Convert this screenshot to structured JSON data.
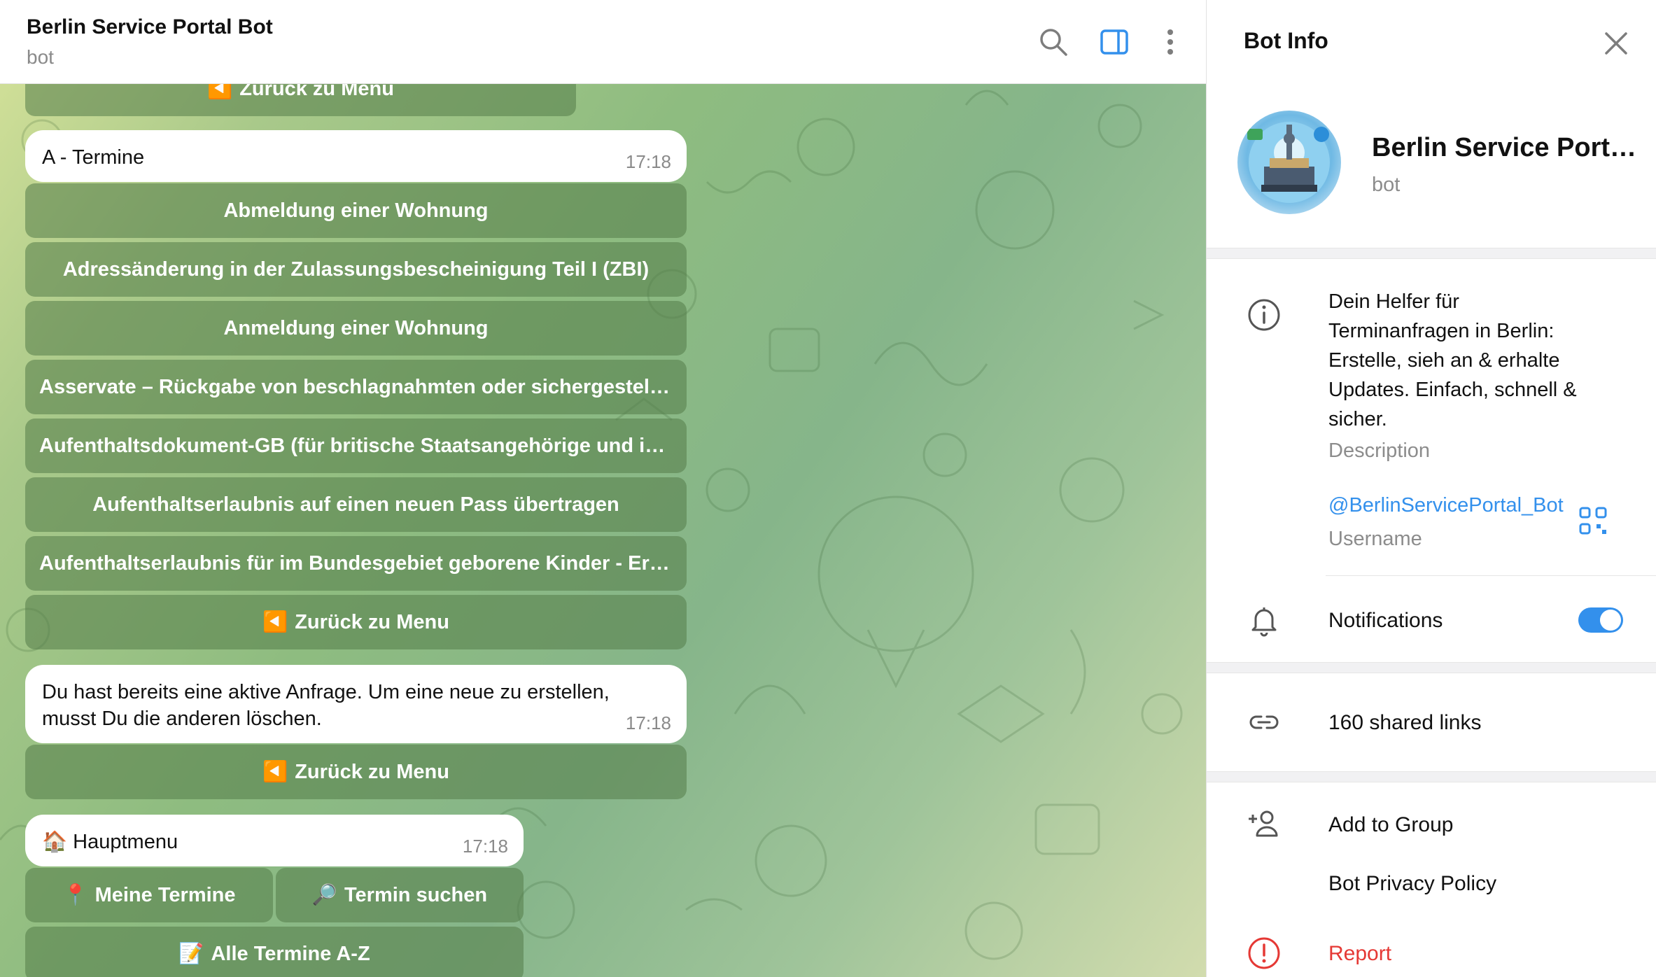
{
  "chat": {
    "title": "Berlin Service Portal Bot",
    "subtitle": "bot",
    "header_icons": [
      "search-icon",
      "sidebar-toggle-icon",
      "more-vertical-icon"
    ]
  },
  "messages": [
    {
      "text": "A - Termine",
      "time": "17:18",
      "buttons": [
        "Abmeldung einer Wohnung",
        "Adressänderung in der Zulassungsbescheinigung Teil I (ZBI)",
        "Anmeldung einer Wohnung",
        "Asservate – Rückgabe von beschlagnahmten oder sichergestellte…",
        "Aufenthaltsdokument-GB (für britische Staatsangehörige und ihr…",
        "Aufenthaltserlaubnis auf einen neuen Pass übertragen",
        "Aufenthaltserlaubnis für im Bundesgebiet geborene Kinder - Erte…"
      ],
      "back": {
        "emoji": "◀️",
        "label": "Zurück zu Menu"
      }
    },
    {
      "text_line1": "Du hast bereits eine aktive Anfrage. Um eine neue zu erstellen,",
      "text_line2": "musst Du die anderen löschen.",
      "time": "17:18",
      "back": {
        "emoji": "◀️",
        "label": "Zurück zu Menu"
      }
    },
    {
      "emoji": "🏠",
      "text": "Hauptmenu",
      "time": "17:18",
      "buttons": [
        {
          "emoji": "📍",
          "label": "Meine Termine"
        },
        {
          "emoji": "🔎",
          "label": "Termin suchen"
        },
        {
          "emoji": "📝",
          "label": "Alle Termine A-Z"
        }
      ]
    }
  ],
  "top_partial_button": {
    "emoji": "◀️",
    "label": "Zurück zu Menu"
  },
  "panel": {
    "title": "Bot Info",
    "name": "Berlin Service Port…",
    "type": "bot",
    "description_lines": [
      "Dein Helfer für",
      "Terminanfragen in Berlin:",
      "Erstelle, sieh an & erhalte",
      "Updates. Einfach, schnell &",
      "sicher."
    ],
    "description_label": "Description",
    "username": "@BerlinServicePortal_Bot",
    "username_label": "Username",
    "notifications_label": "Notifications",
    "notifications_on": true,
    "shared_links": "160 shared links",
    "add_to_group": "Add to Group",
    "privacy_policy": "Bot Privacy Policy",
    "report": "Report",
    "accent_color": "#3390ec",
    "danger_color": "#e53935"
  }
}
